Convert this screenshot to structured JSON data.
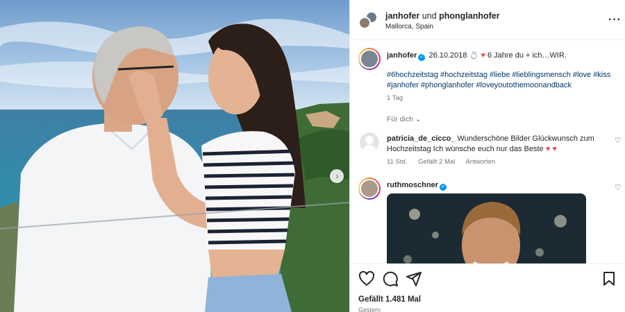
{
  "header": {
    "user1": "janhofer",
    "connector": "und",
    "user2": "phonglanhofer",
    "location": "Mallorca, Spain"
  },
  "caption": {
    "username": "janhofer",
    "text_before_ring": "26.10.2018",
    "text_after_heart": "6 Jahre du + ich…WIR.",
    "hashtags": "#6hochzeitstag #hochzeitstag #liebe #lieblingsmensch #love #kiss #janhofer #phonglanhofer #loveyoutothemoonandback",
    "time": "1 Tag"
  },
  "for_you_label": "Für dich",
  "comments": [
    {
      "username": "patricia_de_cicco_",
      "text": "Wunderschöne Bilder Glückwunsch zum Hochzeitstag Ich wünsche euch nur das Beste",
      "time": "11 Std.",
      "likes": "Gefällt 2 Mal",
      "reply": "Antworten"
    },
    {
      "username": "ruthmoschner"
    }
  ],
  "footer": {
    "likes": "Gefällt 1.481 Mal",
    "date": "Gestern"
  },
  "colors": {
    "link_blue": "#00376b",
    "verified_blue": "#0095f6",
    "heart_pink": "#ed4956",
    "muted": "#737373"
  },
  "icons": [
    "more-icon",
    "verified-icon",
    "ring-icon",
    "heart-icon",
    "chevron-down-icon",
    "like-icon",
    "comment-icon",
    "share-icon",
    "save-icon",
    "next-arrow-icon"
  ]
}
